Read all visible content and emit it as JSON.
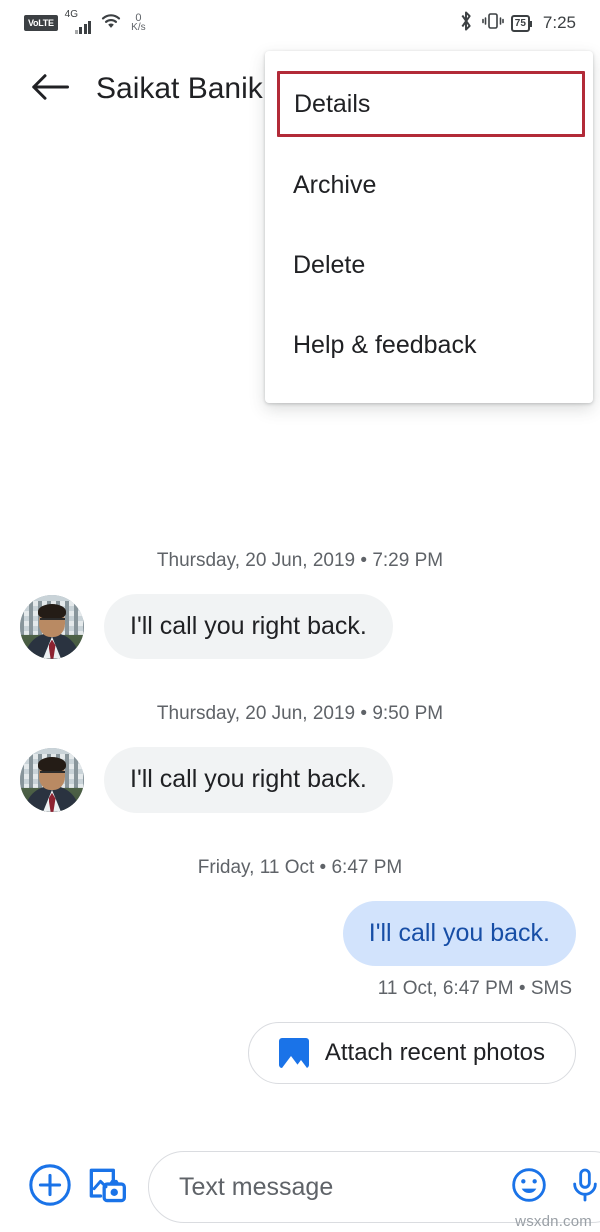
{
  "status_bar": {
    "volte": "VoLTE",
    "network_type": "4G",
    "net_speed_value": "0",
    "net_speed_unit": "K/s",
    "bluetooth_icon": "bluetooth-icon",
    "vibrate_icon": "vibrate-icon",
    "battery_level": "75",
    "time": "7:25"
  },
  "appbar": {
    "back_icon": "back-arrow-icon",
    "title": "Saikat Banik"
  },
  "overflow_menu": {
    "items": [
      {
        "label": "Details",
        "highlighted": true
      },
      {
        "label": "Archive",
        "highlighted": false
      },
      {
        "label": "Delete",
        "highlighted": false
      },
      {
        "label": "Help & feedback",
        "highlighted": false
      }
    ],
    "highlight_color": "#b22a38"
  },
  "conversation": {
    "groups": [
      {
        "daystamp": "Thursday, 20 Jun, 2019 • 7:29 PM",
        "direction": "in",
        "text": "I'll call you right back."
      },
      {
        "daystamp": "Thursday, 20 Jun, 2019 • 9:50 PM",
        "direction": "in",
        "text": "I'll call you right back."
      },
      {
        "daystamp": "Friday, 11 Oct • 6:47 PM",
        "direction": "out",
        "text": "I'll call you back.",
        "meta": "11 Oct, 6:47 PM • SMS"
      }
    ],
    "bubble_in_color": "#f1f3f4",
    "bubble_out_color": "#d2e3fc",
    "bubble_out_text_color": "#174ea6"
  },
  "suggestion_chip": {
    "icon": "photo-icon",
    "label": "Attach recent photos"
  },
  "compose": {
    "plus_icon": "plus-circle-icon",
    "gallery_icon": "gallery-camera-icon",
    "placeholder": "Text message",
    "value": "",
    "emoji_icon": "emoji-smiley-icon",
    "mic_icon": "microphone-icon",
    "accent_color": "#1a73e8"
  },
  "watermark": "wsxdn.com"
}
